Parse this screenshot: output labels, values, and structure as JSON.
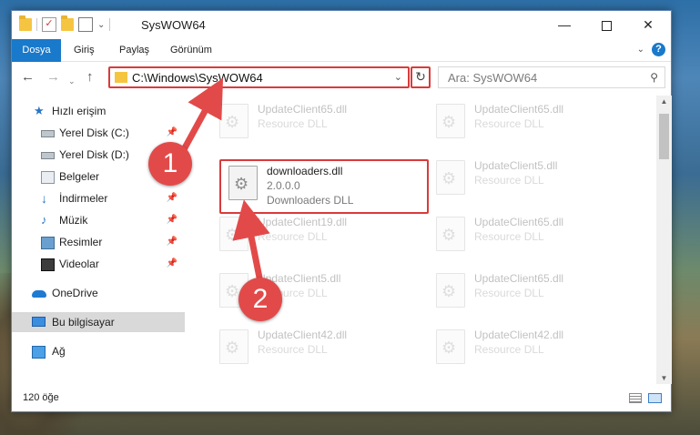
{
  "window": {
    "title": "SysWOW64",
    "minimize_glyph": "—",
    "close_glyph": "✕"
  },
  "ribbon": {
    "tabs": [
      "Dosya",
      "Giriş",
      "Paylaş",
      "Görünüm"
    ],
    "collapse_glyph": "⌄",
    "help_glyph": "?"
  },
  "navbar": {
    "back_glyph": "←",
    "forward_glyph": "→",
    "history_glyph": "⌄",
    "up_glyph": "↑",
    "address": "C:\\Windows\\SysWOW64",
    "address_dropdown_glyph": "⌄",
    "refresh_glyph": "↻",
    "search_placeholder": "Ara: SysWOW64",
    "search_glyph": "⚲"
  },
  "sidebar": {
    "items": [
      {
        "label": "Hızlı erişim",
        "icon": "star-icon"
      },
      {
        "label": "Yerel Disk (C:)",
        "icon": "drive-icon",
        "pinned": true
      },
      {
        "label": "Yerel Disk (D:)",
        "icon": "drive-icon",
        "pinned": true
      },
      {
        "label": "Belgeler",
        "icon": "documents-icon",
        "pinned": true
      },
      {
        "label": "İndirmeler",
        "icon": "download-icon",
        "pinned": true
      },
      {
        "label": "Müzik",
        "icon": "music-icon",
        "pinned": true
      },
      {
        "label": "Resimler",
        "icon": "pictures-icon",
        "pinned": true
      },
      {
        "label": "Videolar",
        "icon": "video-icon",
        "pinned": true
      },
      {
        "label": "OneDrive",
        "icon": "cloud-icon"
      },
      {
        "label": "Bu bilgisayar",
        "icon": "computer-icon",
        "selected": true
      },
      {
        "label": "Ağ",
        "icon": "network-icon"
      }
    ],
    "pin_glyph": "📌"
  },
  "files": {
    "highlighted": {
      "name": "downloaders.dll",
      "version": "2.0.0.0",
      "description": "Downloaders DLL"
    },
    "faded": [
      {
        "name": "UpdateClient65.dll",
        "description": "Resource DLL"
      },
      {
        "name": "UpdateClient65.dll",
        "description": "Resource DLL"
      },
      {
        "name": "UpdateClient5.dll",
        "description": "Resource DLL"
      },
      {
        "name": "UpdateClient19.dll",
        "description": "Resource DLL"
      },
      {
        "name": "UpdateClient65.dll",
        "description": "Resource DLL"
      },
      {
        "name": "UpdateClient5.dll",
        "description": "Resource DLL"
      },
      {
        "name": "UpdateClient65.dll",
        "description": "Resource DLL"
      },
      {
        "name": "UpdateClient42.dll",
        "description": "Resource DLL"
      },
      {
        "name": "UpdateClient42.dll",
        "description": "Resource DLL"
      }
    ],
    "file_glyph": "⚙"
  },
  "status": {
    "item_count": "120 öğe"
  },
  "scrollbar": {
    "up_glyph": "▲",
    "down_glyph": "▼"
  },
  "annotations": {
    "step1": "1",
    "step2": "2",
    "color": "#e24a4a"
  }
}
